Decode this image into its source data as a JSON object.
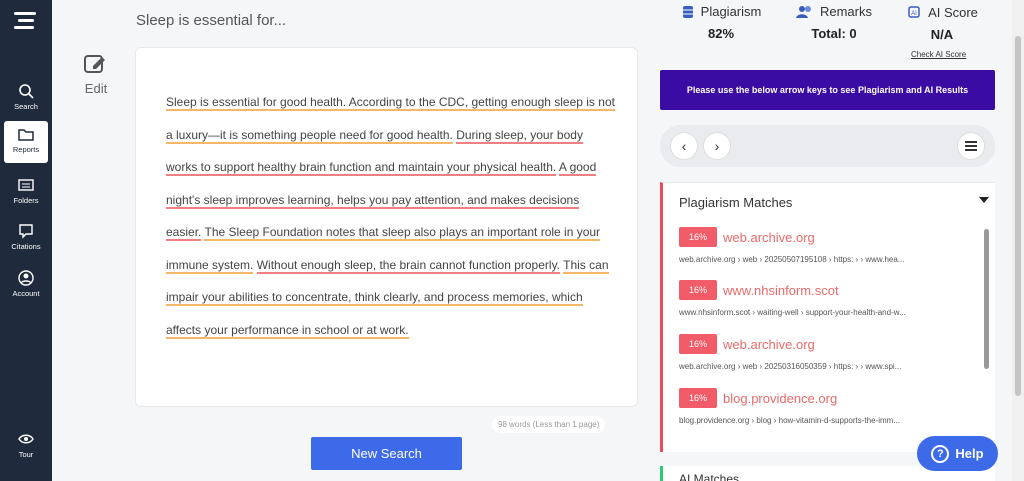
{
  "sidebar": {
    "items": [
      {
        "label": "Search",
        "icon": "search-icon"
      },
      {
        "label": "Reports",
        "icon": "folder-icon"
      },
      {
        "label": "Folders",
        "icon": "list-icon"
      },
      {
        "label": "Citations",
        "icon": "quote-icon"
      },
      {
        "label": "Account",
        "icon": "user-icon"
      },
      {
        "label": "Tour",
        "icon": "eye-icon"
      }
    ]
  },
  "doc": {
    "title": "Sleep is essential for...",
    "edit_label": "Edit",
    "words": "98 words (Less than 1 page)",
    "new_search_label": "New Search",
    "segments": [
      {
        "text": "Sleep is essential for good health. According to the CDC, getting enough sleep is not a luxury—it is something people need for good health.",
        "style": "u-org"
      },
      {
        "text": " ",
        "style": ""
      },
      {
        "text": "During sleep, your body works to support healthy brain function and maintain your physical health.",
        "style": "u-red"
      },
      {
        "text": " ",
        "style": ""
      },
      {
        "text": "A good night's sleep improves learning, helps you pay attention, and makes decisions easier.",
        "style": "u-red"
      },
      {
        "text": " ",
        "style": ""
      },
      {
        "text": "The Sleep Foundation notes that sleep also plays an important role in your immune system.",
        "style": "u-org"
      },
      {
        "text": " ",
        "style": ""
      },
      {
        "text": "Without enough sleep, the brain cannot function properly.",
        "style": "u-red"
      },
      {
        "text": " ",
        "style": ""
      },
      {
        "text": "This can impair your abilities to concentrate, think clearly, and process memories, which affects your performance in school or at work.",
        "style": "u-org"
      }
    ]
  },
  "stats": {
    "plagiarism": {
      "label": "Plagiarism",
      "value": "82%"
    },
    "remarks": {
      "label": "Remarks",
      "value": "Total: 0"
    },
    "ai": {
      "label": "AI Score",
      "value": "N/A"
    },
    "check_ai": "Check AI Score"
  },
  "banner": "Please use the below arrow keys to see Plagiarism and AI Results",
  "matches": {
    "title": "Plagiarism Matches",
    "items": [
      {
        "pct": "16%",
        "domain": "web.archive.org",
        "path": "web.archive.org  ›  web  ›  20250507195108  ›  https:  ›   ›  www.hea..."
      },
      {
        "pct": "16%",
        "domain": "www.nhsinform.scot",
        "path": "www.nhsinform.scot  ›  waiting-well  ›  support-your-health-and-w..."
      },
      {
        "pct": "16%",
        "domain": "web.archive.org",
        "path": "web.archive.org  ›  web  ›  20250316050359  ›  https:  ›   ›  www.spi..."
      },
      {
        "pct": "16%",
        "domain": "blog.providence.org",
        "path": "blog.providence.org  ›  blog  ›  how-vitamin-d-supports-the-imm..."
      }
    ]
  },
  "ai_matches": {
    "title": "AI Matches"
  },
  "help": {
    "label": "Help",
    "icon": "question-icon"
  },
  "colors": {
    "sidebar": "#1f2a3c",
    "banner": "#3a0ca3",
    "accent": "#3d6ae8",
    "match_red": "#f25c68"
  }
}
